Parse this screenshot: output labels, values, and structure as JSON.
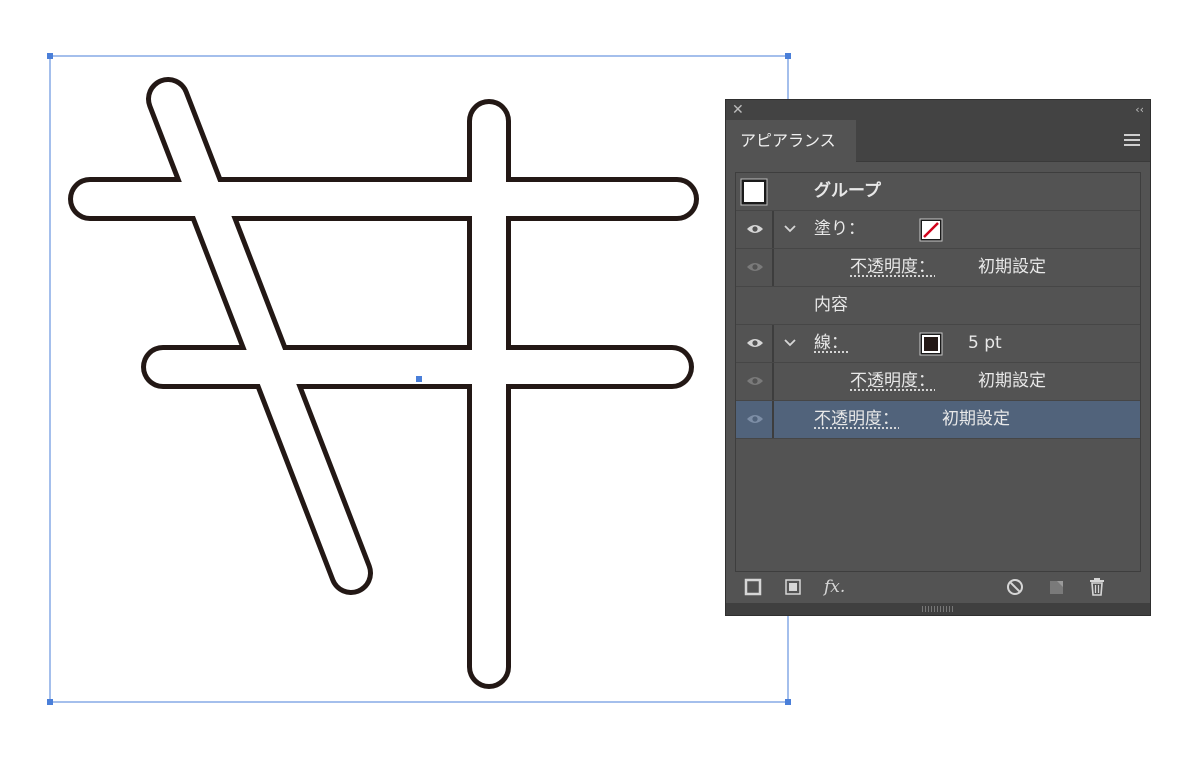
{
  "panel": {
    "close_glyph": "✕",
    "collapse_glyph": "‹‹",
    "tab_label": "アピアランス",
    "menu_icon": "hamburger-menu-icon"
  },
  "rows": {
    "group": {
      "label": "グループ"
    },
    "fill": {
      "label": "塗り：",
      "swatch": "none-red-slash"
    },
    "fill_opacity": {
      "label": "不透明度：",
      "value": "初期設定"
    },
    "contents": {
      "label": "内容"
    },
    "stroke": {
      "label": "線：",
      "value": "5 pt",
      "swatch": "#231815"
    },
    "stroke_opacity": {
      "label": "不透明度：",
      "value": "初期設定"
    },
    "group_opacity": {
      "label": "不透明度：",
      "value": "初期設定"
    }
  },
  "toolbar": {
    "add_stroke_icon": "add-new-stroke-icon",
    "add_fill_icon": "add-new-fill-icon",
    "fx_label": "fx.",
    "clear_icon": "clear-appearance-icon",
    "duplicate_icon": "duplicate-item-icon",
    "delete_icon": "trash-icon"
  },
  "colors": {
    "selection": "#4a7fd9",
    "glyph_stroke": "#231815",
    "panel_bg": "#535353",
    "panel_header": "#434343",
    "row_selected": "#51637b"
  }
}
